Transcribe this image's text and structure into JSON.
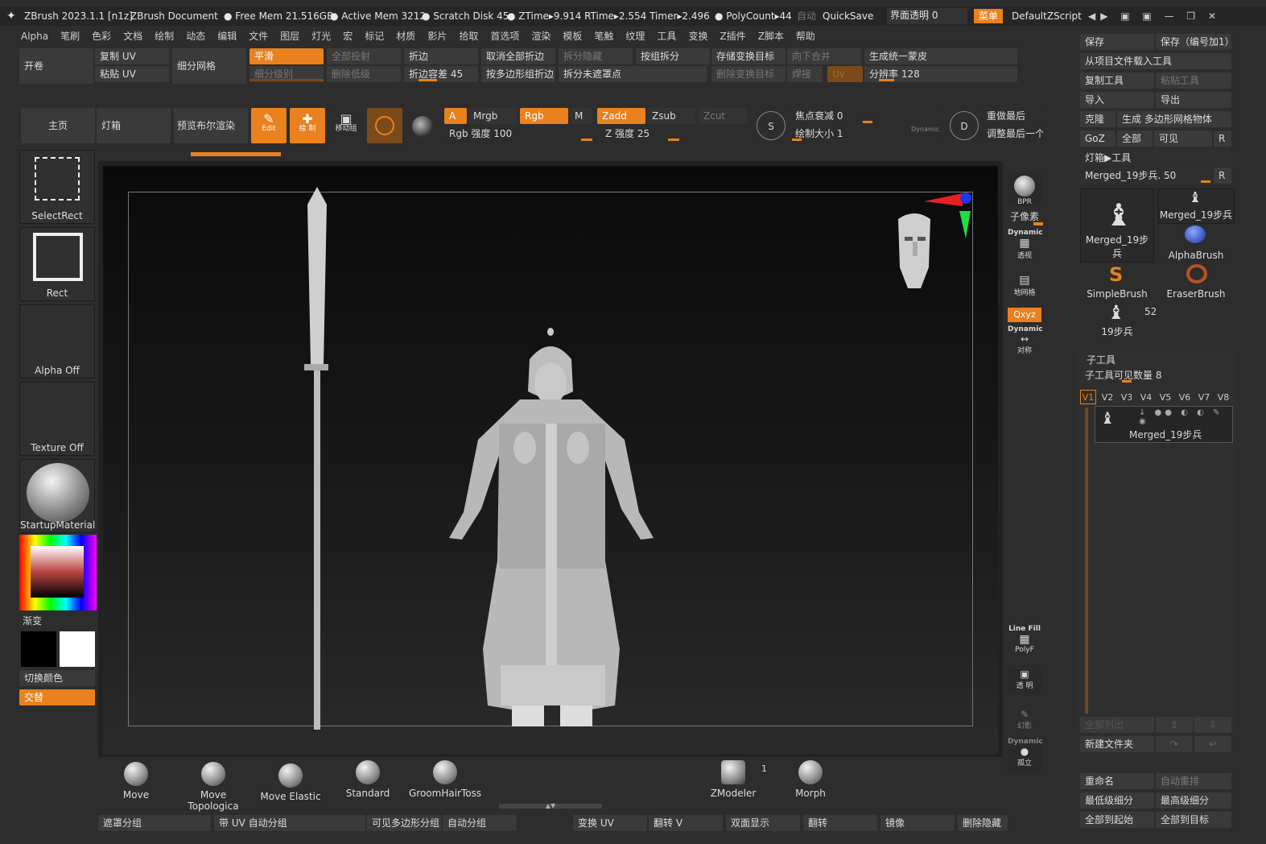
{
  "titlebar": {
    "app": "ZBrush 2023.1.1 [n1z]",
    "document": "ZBrush Document",
    "free_mem": "Free Mem 21.516GB",
    "active_mem": "Active Mem 3212",
    "scratch": "Scratch Disk 45",
    "ztime": "ZTime▸9.914 RTime▸2.554 Timer▸2.496",
    "polycount": "PolyCount▸44",
    "auto": "自动",
    "quicksave": "QuickSave",
    "transparency": "界面透明 0",
    "menu_btn": "菜单",
    "script": "DefaultZScript"
  },
  "menubar": [
    "Alpha",
    "笔刷",
    "色彩",
    "文档",
    "绘制",
    "动态",
    "编辑",
    "文件",
    "图层",
    "灯光",
    "宏",
    "标记",
    "材质",
    "影片",
    "拾取",
    "首选项",
    "渲染",
    "模板",
    "笔触",
    "纹理",
    "工具",
    "变换",
    "Z插件",
    "Z脚本",
    "帮助"
  ],
  "toolbar1": {
    "kaijuan": "开卷",
    "copy_uv": "复制 UV",
    "paste_uv": "粘贴 UV",
    "subdiv_mesh": "细分网格",
    "smooth": "平滑",
    "subdiv_level": "细分级别",
    "project_all": "全部投射",
    "delete_lower": "删除低级",
    "crease": "折边",
    "crease_tol": "折边容差 45",
    "uncrease_all": "取消全部折边",
    "crease_pg": "按多边形组折边",
    "split_hidden": "拆分隐藏",
    "split_unmasked": "拆分未遮罩点",
    "group_split": "按组拆分",
    "store_morph": "存储变换目标",
    "delete_morph": "删除变换目标",
    "merge_down": "向下合并",
    "weld": "焊接",
    "uv": "Uv",
    "unify_skin": "生成统一蒙皮",
    "resolution": "分辨率 128"
  },
  "toolbar2": {
    "home": "主页",
    "lightbox": "灯箱",
    "preview_bool": "预览布尔渲染",
    "edit": "Edit",
    "draw": "绘 制",
    "move": "移动组",
    "a": "A",
    "mrgb": "Mrgb",
    "rgb": "Rgb",
    "m": "M",
    "zadd": "Zadd",
    "zsub": "Zsub",
    "zcut": "Zcut",
    "rgb_intensity": "Rgb 强度 100",
    "z_intensity": "Z 强度 25",
    "focal_shift": "焦点衰减 0",
    "draw_size": "绘制大小 1",
    "dynamic": "Dynamic",
    "redo_last": "重做最后",
    "adjust_last": "调整最后一个"
  },
  "left_panel": {
    "select_rect": "SelectRect",
    "rect": "Rect",
    "alpha_off": "Alpha Off",
    "texture_off": "Texture Off",
    "material": "StartupMaterial",
    "gradient": "渐变",
    "switch_color": "切换颜色",
    "alternate": "交替"
  },
  "right_strip": {
    "bpr": "BPR",
    "subpixel": "子像素",
    "dynamic": "Dynamic",
    "persp": "透视",
    "floor": "地网格",
    "xyz": "Qxyz",
    "sym": "对称",
    "linefill": "Line Fill",
    "polyf": "PolyF",
    "transp": "透 明",
    "ghost": "幻影",
    "solo": "孤立"
  },
  "right_panel": {
    "top1": "保存",
    "top2": "保存（编号加1）",
    "load_project": "从项目文件载入工具",
    "copy_tool": "复制工具",
    "paste_tool": "粘贴工具",
    "import": "导入",
    "export": "导出",
    "clone": "克隆",
    "make_polymesh": "生成 多边形网格物体",
    "goz": "GoZ",
    "all": "全部",
    "visible": "可见",
    "r": "R",
    "lightbox_tools": "灯箱▶工具",
    "current_tool": "Merged_19步兵. 50",
    "thumbs": [
      "Merged_19步兵",
      "Merged_19步兵",
      "AlphaBrush",
      "SimpleBrush",
      "EraserBrush",
      "19步兵"
    ],
    "count52": "52",
    "subtool_title": "子工具",
    "subtool_visible": "子工具可见数量 8",
    "vtabs": [
      "V1",
      "V2",
      "V3",
      "V4",
      "V5",
      "V6",
      "V7",
      "V8"
    ],
    "subtool_name": "Merged_19步兵",
    "list_all": "全部列出",
    "new_folder": "新建文件夹",
    "rename": "重命名",
    "auto_reorder": "自动重排",
    "lowest_sub": "最低级细分",
    "highest_sub": "最高级细分",
    "all_to_start": "全部到起始",
    "all_to_target": "全部到目标"
  },
  "brushes": [
    "Move",
    "Move Topologica",
    "Move Elastic",
    "Standard",
    "GroomHairToss",
    "ZModeler",
    "Morph"
  ],
  "zmodeler_count": "1",
  "bottom": [
    "遮罩分组",
    "带 UV 自动分组",
    "可见多边形分组",
    "自动分组",
    "变换 UV",
    "翻转 V",
    "双面显示",
    "翻转",
    "镜像",
    "删除隐藏"
  ],
  "colors": {
    "accent": "#e8811e",
    "panel": "#2d2d2d",
    "button": "#3a3a3a",
    "canvas": "#1a1a1a"
  }
}
